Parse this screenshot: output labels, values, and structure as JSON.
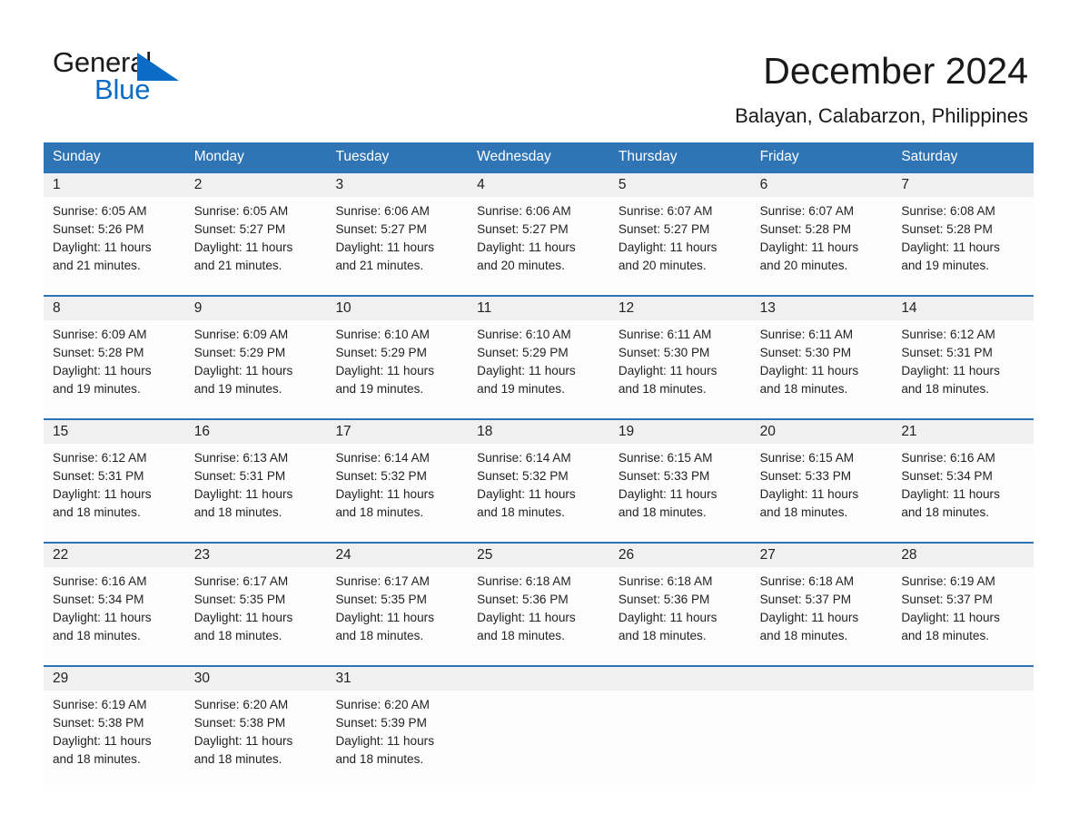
{
  "brand": {
    "name_part1": "General",
    "name_part2": "Blue",
    "triangle_color": "#0a6cc4",
    "text_color": "#1a1a1a"
  },
  "header": {
    "title": "December 2024",
    "subtitle": "Balayan, Calabarzon, Philippines"
  },
  "theme": {
    "header_blue": "#2f74b5",
    "date_band_gray": "#f0f0f0",
    "body_bg": "#fdfdfd",
    "text": "#222222"
  },
  "calendar": {
    "weekdays": [
      "Sunday",
      "Monday",
      "Tuesday",
      "Wednesday",
      "Thursday",
      "Friday",
      "Saturday"
    ],
    "weeks": [
      {
        "dates": [
          "1",
          "2",
          "3",
          "4",
          "5",
          "6",
          "7"
        ],
        "cells": [
          {
            "sunrise": "Sunrise: 6:05 AM",
            "sunset": "Sunset: 5:26 PM",
            "daylight_l1": "Daylight: 11 hours",
            "daylight_l2": "and 21 minutes."
          },
          {
            "sunrise": "Sunrise: 6:05 AM",
            "sunset": "Sunset: 5:27 PM",
            "daylight_l1": "Daylight: 11 hours",
            "daylight_l2": "and 21 minutes."
          },
          {
            "sunrise": "Sunrise: 6:06 AM",
            "sunset": "Sunset: 5:27 PM",
            "daylight_l1": "Daylight: 11 hours",
            "daylight_l2": "and 21 minutes."
          },
          {
            "sunrise": "Sunrise: 6:06 AM",
            "sunset": "Sunset: 5:27 PM",
            "daylight_l1": "Daylight: 11 hours",
            "daylight_l2": "and 20 minutes."
          },
          {
            "sunrise": "Sunrise: 6:07 AM",
            "sunset": "Sunset: 5:27 PM",
            "daylight_l1": "Daylight: 11 hours",
            "daylight_l2": "and 20 minutes."
          },
          {
            "sunrise": "Sunrise: 6:07 AM",
            "sunset": "Sunset: 5:28 PM",
            "daylight_l1": "Daylight: 11 hours",
            "daylight_l2": "and 20 minutes."
          },
          {
            "sunrise": "Sunrise: 6:08 AM",
            "sunset": "Sunset: 5:28 PM",
            "daylight_l1": "Daylight: 11 hours",
            "daylight_l2": "and 19 minutes."
          }
        ]
      },
      {
        "dates": [
          "8",
          "9",
          "10",
          "11",
          "12",
          "13",
          "14"
        ],
        "cells": [
          {
            "sunrise": "Sunrise: 6:09 AM",
            "sunset": "Sunset: 5:28 PM",
            "daylight_l1": "Daylight: 11 hours",
            "daylight_l2": "and 19 minutes."
          },
          {
            "sunrise": "Sunrise: 6:09 AM",
            "sunset": "Sunset: 5:29 PM",
            "daylight_l1": "Daylight: 11 hours",
            "daylight_l2": "and 19 minutes."
          },
          {
            "sunrise": "Sunrise: 6:10 AM",
            "sunset": "Sunset: 5:29 PM",
            "daylight_l1": "Daylight: 11 hours",
            "daylight_l2": "and 19 minutes."
          },
          {
            "sunrise": "Sunrise: 6:10 AM",
            "sunset": "Sunset: 5:29 PM",
            "daylight_l1": "Daylight: 11 hours",
            "daylight_l2": "and 19 minutes."
          },
          {
            "sunrise": "Sunrise: 6:11 AM",
            "sunset": "Sunset: 5:30 PM",
            "daylight_l1": "Daylight: 11 hours",
            "daylight_l2": "and 18 minutes."
          },
          {
            "sunrise": "Sunrise: 6:11 AM",
            "sunset": "Sunset: 5:30 PM",
            "daylight_l1": "Daylight: 11 hours",
            "daylight_l2": "and 18 minutes."
          },
          {
            "sunrise": "Sunrise: 6:12 AM",
            "sunset": "Sunset: 5:31 PM",
            "daylight_l1": "Daylight: 11 hours",
            "daylight_l2": "and 18 minutes."
          }
        ]
      },
      {
        "dates": [
          "15",
          "16",
          "17",
          "18",
          "19",
          "20",
          "21"
        ],
        "cells": [
          {
            "sunrise": "Sunrise: 6:12 AM",
            "sunset": "Sunset: 5:31 PM",
            "daylight_l1": "Daylight: 11 hours",
            "daylight_l2": "and 18 minutes."
          },
          {
            "sunrise": "Sunrise: 6:13 AM",
            "sunset": "Sunset: 5:31 PM",
            "daylight_l1": "Daylight: 11 hours",
            "daylight_l2": "and 18 minutes."
          },
          {
            "sunrise": "Sunrise: 6:14 AM",
            "sunset": "Sunset: 5:32 PM",
            "daylight_l1": "Daylight: 11 hours",
            "daylight_l2": "and 18 minutes."
          },
          {
            "sunrise": "Sunrise: 6:14 AM",
            "sunset": "Sunset: 5:32 PM",
            "daylight_l1": "Daylight: 11 hours",
            "daylight_l2": "and 18 minutes."
          },
          {
            "sunrise": "Sunrise: 6:15 AM",
            "sunset": "Sunset: 5:33 PM",
            "daylight_l1": "Daylight: 11 hours",
            "daylight_l2": "and 18 minutes."
          },
          {
            "sunrise": "Sunrise: 6:15 AM",
            "sunset": "Sunset: 5:33 PM",
            "daylight_l1": "Daylight: 11 hours",
            "daylight_l2": "and 18 minutes."
          },
          {
            "sunrise": "Sunrise: 6:16 AM",
            "sunset": "Sunset: 5:34 PM",
            "daylight_l1": "Daylight: 11 hours",
            "daylight_l2": "and 18 minutes."
          }
        ]
      },
      {
        "dates": [
          "22",
          "23",
          "24",
          "25",
          "26",
          "27",
          "28"
        ],
        "cells": [
          {
            "sunrise": "Sunrise: 6:16 AM",
            "sunset": "Sunset: 5:34 PM",
            "daylight_l1": "Daylight: 11 hours",
            "daylight_l2": "and 18 minutes."
          },
          {
            "sunrise": "Sunrise: 6:17 AM",
            "sunset": "Sunset: 5:35 PM",
            "daylight_l1": "Daylight: 11 hours",
            "daylight_l2": "and 18 minutes."
          },
          {
            "sunrise": "Sunrise: 6:17 AM",
            "sunset": "Sunset: 5:35 PM",
            "daylight_l1": "Daylight: 11 hours",
            "daylight_l2": "and 18 minutes."
          },
          {
            "sunrise": "Sunrise: 6:18 AM",
            "sunset": "Sunset: 5:36 PM",
            "daylight_l1": "Daylight: 11 hours",
            "daylight_l2": "and 18 minutes."
          },
          {
            "sunrise": "Sunrise: 6:18 AM",
            "sunset": "Sunset: 5:36 PM",
            "daylight_l1": "Daylight: 11 hours",
            "daylight_l2": "and 18 minutes."
          },
          {
            "sunrise": "Sunrise: 6:18 AM",
            "sunset": "Sunset: 5:37 PM",
            "daylight_l1": "Daylight: 11 hours",
            "daylight_l2": "and 18 minutes."
          },
          {
            "sunrise": "Sunrise: 6:19 AM",
            "sunset": "Sunset: 5:37 PM",
            "daylight_l1": "Daylight: 11 hours",
            "daylight_l2": "and 18 minutes."
          }
        ]
      },
      {
        "dates": [
          "29",
          "30",
          "31",
          "",
          "",
          "",
          ""
        ],
        "cells": [
          {
            "sunrise": "Sunrise: 6:19 AM",
            "sunset": "Sunset: 5:38 PM",
            "daylight_l1": "Daylight: 11 hours",
            "daylight_l2": "and 18 minutes."
          },
          {
            "sunrise": "Sunrise: 6:20 AM",
            "sunset": "Sunset: 5:38 PM",
            "daylight_l1": "Daylight: 11 hours",
            "daylight_l2": "and 18 minutes."
          },
          {
            "sunrise": "Sunrise: 6:20 AM",
            "sunset": "Sunset: 5:39 PM",
            "daylight_l1": "Daylight: 11 hours",
            "daylight_l2": "and 18 minutes."
          },
          {
            "sunrise": "",
            "sunset": "",
            "daylight_l1": "",
            "daylight_l2": ""
          },
          {
            "sunrise": "",
            "sunset": "",
            "daylight_l1": "",
            "daylight_l2": ""
          },
          {
            "sunrise": "",
            "sunset": "",
            "daylight_l1": "",
            "daylight_l2": ""
          },
          {
            "sunrise": "",
            "sunset": "",
            "daylight_l1": "",
            "daylight_l2": ""
          }
        ]
      }
    ]
  }
}
